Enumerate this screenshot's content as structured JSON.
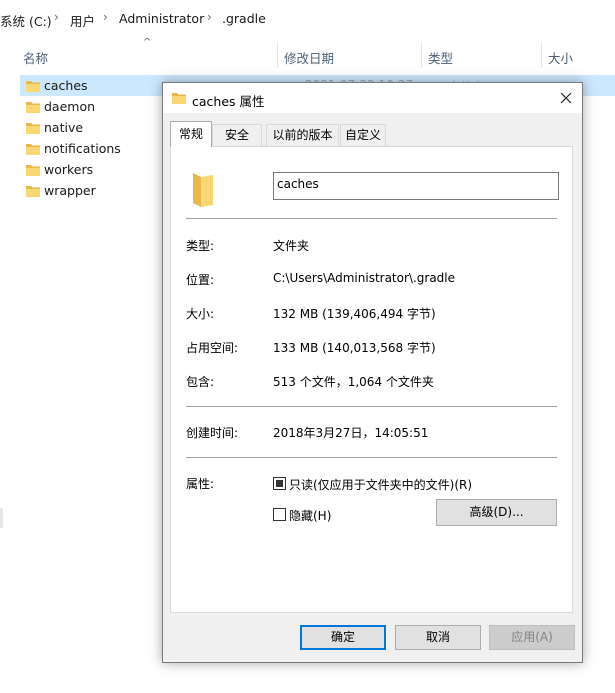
{
  "breadcrumb": {
    "items": [
      "系统 (C:)",
      "用户",
      "Administrator",
      ".gradle"
    ],
    "separator": "›"
  },
  "columns": {
    "name": "名称",
    "modified": "修改日期",
    "type": "类型",
    "size": "大小"
  },
  "files": [
    {
      "name": "caches",
      "selected": true,
      "date_ghost": "2021-07-22 10:27",
      "type_ghost": "文件夹"
    },
    {
      "name": "daemon"
    },
    {
      "name": "native"
    },
    {
      "name": "notifications"
    },
    {
      "name": "workers"
    },
    {
      "name": "wrapper"
    }
  ],
  "dialog": {
    "title": "caches 属性",
    "tabs": [
      "常规",
      "安全",
      "以前的版本",
      "自定义"
    ],
    "active_tab": "常规",
    "folder_name": "caches",
    "props": {
      "type_label": "类型:",
      "type_value": "文件夹",
      "location_label": "位置:",
      "location_value": "C:\\Users\\Administrator\\.gradle",
      "size_label": "大小:",
      "size_value": "132 MB (139,406,494 字节)",
      "disk_label": "占用空间:",
      "disk_value": "133 MB (140,013,568 字节)",
      "contains_label": "包含:",
      "contains_value": "513 个文件，1,064 个文件夹",
      "created_label": "创建时间:",
      "created_value": "2018年3月27日，14:05:51",
      "attributes_label": "属性:"
    },
    "attributes": {
      "readonly_label": "只读(仅应用于文件夹中的文件)(R)",
      "readonly_state": "indeterminate",
      "hidden_label": "隐藏(H)",
      "hidden_state": "unchecked",
      "advanced_button": "高级(D)..."
    },
    "buttons": {
      "ok": "确定",
      "cancel": "取消",
      "apply": "应用(A)"
    }
  },
  "colors": {
    "folder": "#f8d775",
    "folder_dark": "#e8b94a",
    "selection": "#cce8ff",
    "accent": "#0078d7"
  }
}
